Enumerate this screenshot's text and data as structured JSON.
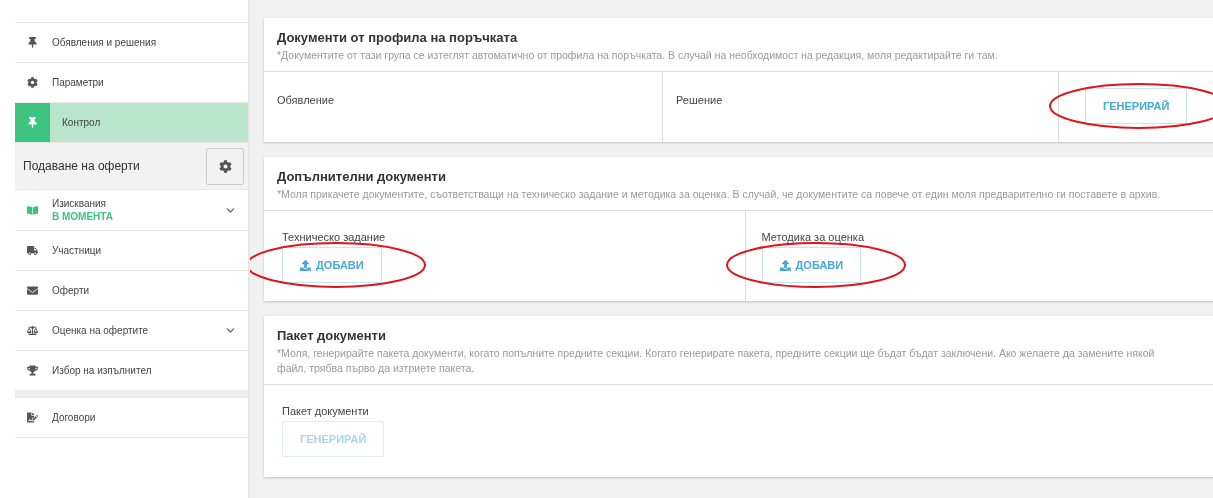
{
  "sidebar": {
    "items": [
      {
        "label": "Обявления и решения",
        "selected": false
      },
      {
        "label": "Параметри",
        "selected": false
      },
      {
        "label": "Контрол",
        "selected": true
      }
    ],
    "section": {
      "title": "Подаване на оферти"
    },
    "section_items": [
      {
        "label": "Изисквания",
        "status": "В МОМЕНТА",
        "expandable": true
      },
      {
        "label": "Участници",
        "expandable": false
      },
      {
        "label": "Оферти",
        "expandable": false
      },
      {
        "label": "Оценка на офертите",
        "expandable": true
      },
      {
        "label": "Избор на изпълнител",
        "expandable": false
      }
    ],
    "after_gap_items": [
      {
        "label": "Договори",
        "expandable": false
      }
    ]
  },
  "cards": [
    {
      "title": "Документи от профила на поръчката",
      "note": "*Документите от тази група се изтеглят автоматично от профила на поръчката. В случай на необходимост на редакция, моля редактирайте ги там.",
      "cells": [
        {
          "label": "Обявление"
        },
        {
          "label": "Решение"
        },
        {
          "button": {
            "kind": "generate",
            "label": "ГЕНЕРИРАЙ",
            "disabled": false,
            "highlighted": true
          }
        }
      ]
    },
    {
      "title": "Допълнителни документи",
      "note": "*Моля прикачете документите, съответстващи на техническо задание и методика за оценка. В случай, че документите са повече от един моля предварително ги поставете в архив.",
      "cells": [
        {
          "label": "Техническо задание",
          "button": {
            "kind": "upload",
            "label": "ДОБАВИ",
            "disabled": false,
            "highlighted": true
          }
        },
        {
          "label": "Методика за оценка",
          "button": {
            "kind": "upload",
            "label": "ДОБАВИ",
            "disabled": false,
            "highlighted": true
          }
        }
      ]
    },
    {
      "title": "Пакет документи",
      "note": "*Моля, генерирайте пакета документи, когато попълните предните секции. Когато генерирате пакета, предните секции ще бъдат бъдат заключени. Ако желаете да замените някой файл, трябва първо да изтриете пакета.",
      "cells": [
        {
          "label": "Пакет документи",
          "button": {
            "kind": "generate",
            "label": "ГЕНЕРИРАЙ",
            "disabled": true,
            "highlighted": false
          }
        }
      ]
    }
  ]
}
